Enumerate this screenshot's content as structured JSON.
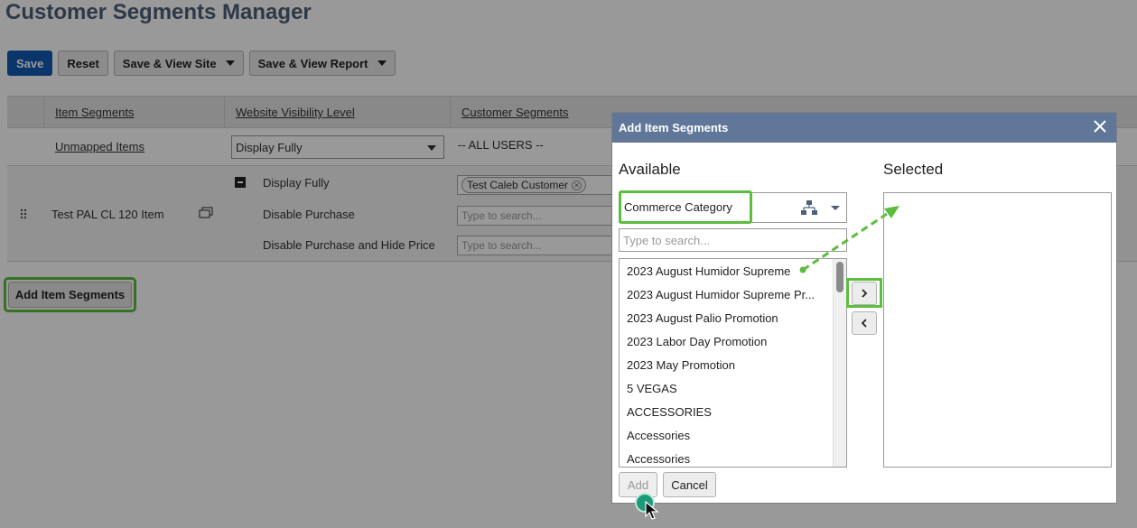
{
  "page": {
    "title": "Customer Segments Manager"
  },
  "toolbar": {
    "save": "Save",
    "reset": "Reset",
    "save_view_site": "Save & View Site",
    "save_view_report": "Save & View Report"
  },
  "grid": {
    "headers": {
      "item_segments": "Item Segments",
      "visibility": "Website Visibility Level",
      "customer_segments": "Customer Segments"
    },
    "unmapped": {
      "label": "Unmapped Items",
      "visibility": "Display Fully",
      "customers": "-- ALL USERS --"
    },
    "item_row": {
      "item": "Test PAL CL 120 Item",
      "levels": [
        "Display Fully",
        "Disable Purchase",
        "Disable Purchase and Hide Price"
      ],
      "chip": "Test Caleb Customer",
      "search_placeholder": "Type to search..."
    }
  },
  "add_segments_button": "Add Item Segments",
  "modal": {
    "title": "Add Item Segments",
    "available_heading": "Available",
    "selected_heading": "Selected",
    "category": "Commerce Category",
    "search_placeholder": "Type to search...",
    "items": [
      "2023 August Humidor Supreme",
      "2023 August Humidor Supreme Pr...",
      "2023 August Palio Promotion",
      "2023 Labor Day Promotion",
      "2023 May Promotion",
      "5 VEGAS",
      "ACCESSORIES",
      "Accessories",
      "Accessories"
    ],
    "add": "Add",
    "cancel": "Cancel"
  },
  "colors": {
    "highlight": "#5cbd3f",
    "modal_header": "#607799",
    "primary": "#125ab2"
  }
}
